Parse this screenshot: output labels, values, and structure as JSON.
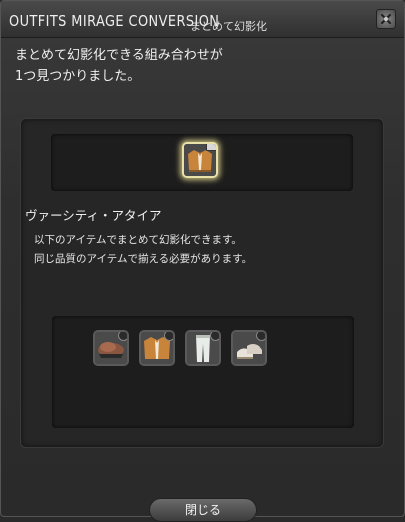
{
  "window": {
    "title_en": "OUTFITS MIRAGE CONVERSION",
    "title_ja": "まとめて幻影化"
  },
  "message": {
    "line1": "まとめて幻影化できる組み合わせが",
    "line2": "1つ見つかりました。"
  },
  "result": {
    "item_name": "ヴァーシティ・アタイア",
    "icon": "varsity-jacket-outfit-icon"
  },
  "description": {
    "line1": "以下のアイテムでまとめて幻影化できます。",
    "line2": "同じ品質のアイテムで揃える必要があります。"
  },
  "set_items": [
    {
      "icon": "varsity-hat-icon"
    },
    {
      "icon": "varsity-jacket-icon"
    },
    {
      "icon": "varsity-trousers-icon"
    },
    {
      "icon": "varsity-shoes-icon"
    }
  ],
  "footer": {
    "close_label": "閉じる"
  },
  "colors": {
    "jacket": "#c8843a",
    "highlight": "#f0e6a0",
    "shoe": "#e8e2d8"
  }
}
